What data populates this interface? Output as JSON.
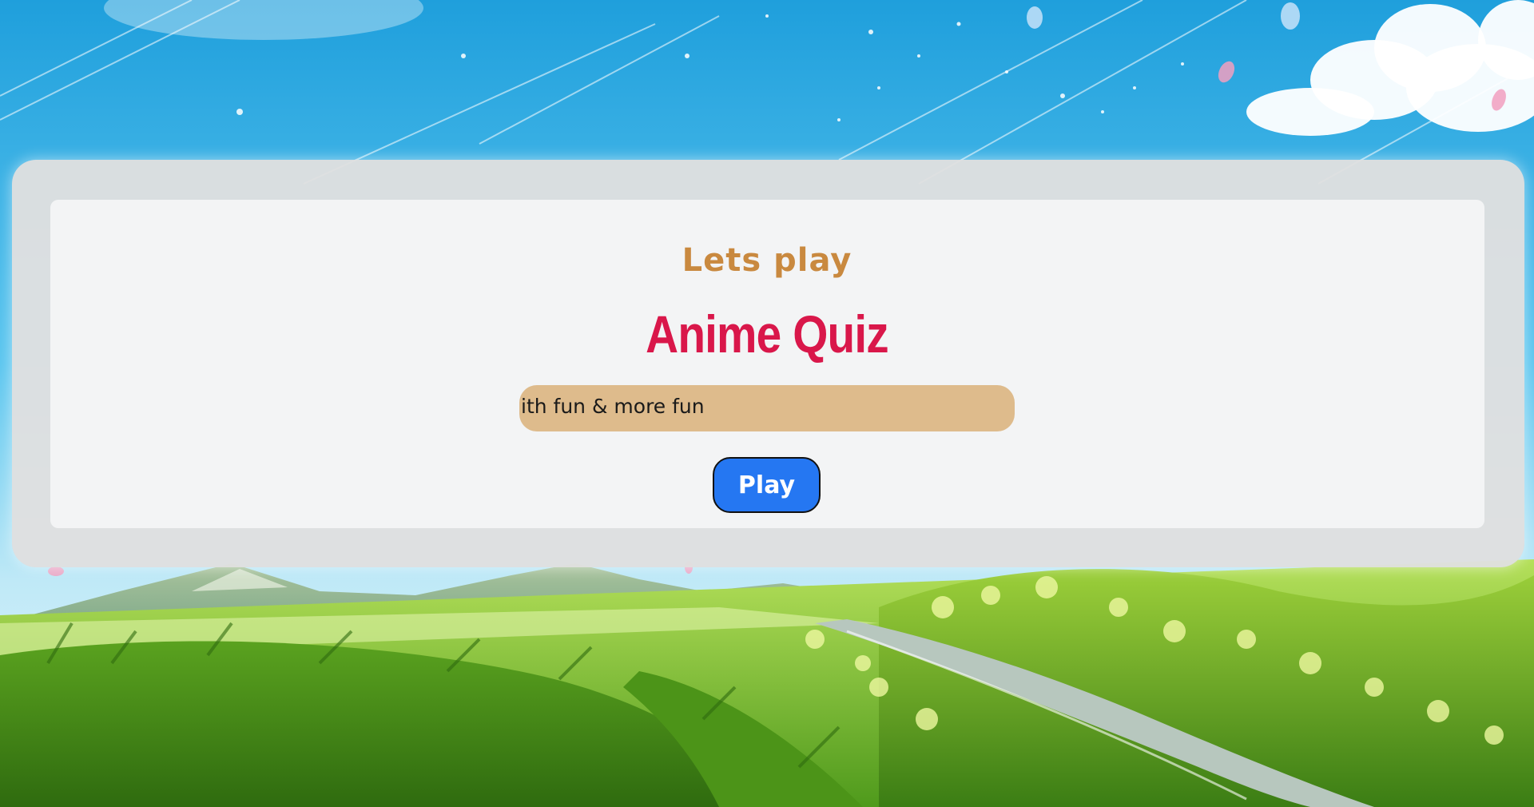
{
  "welcome": {
    "subtitle": "Lets play",
    "title": "Anime Quiz",
    "marquee_text": "ith fun & more fun",
    "play_button_label": "Play"
  },
  "colors": {
    "subtitle": "#c9893f",
    "title": "#d9174a",
    "marquee_background": "#debb8c",
    "play_button": "#2577f2",
    "card_background": "#f3f4f5",
    "panel_background": "#e0e0e0"
  }
}
